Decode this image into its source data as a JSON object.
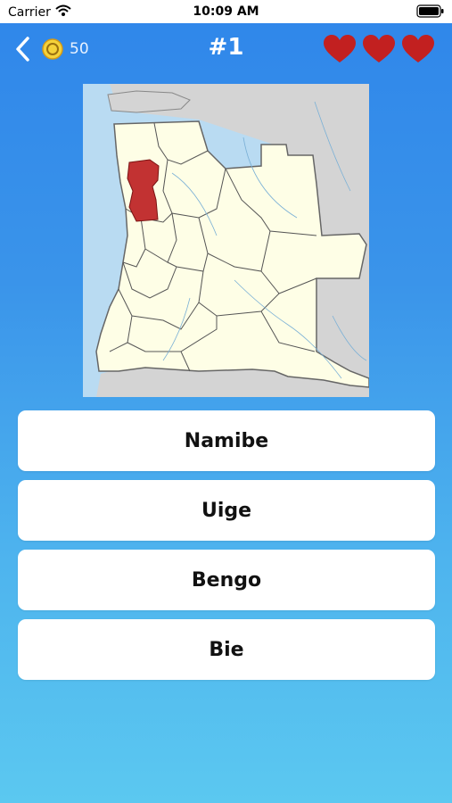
{
  "status_bar": {
    "carrier": "Carrier",
    "time": "10:09 AM"
  },
  "header": {
    "coins": "50",
    "title": "#1",
    "lives": 3
  },
  "answers": [
    {
      "label": "Namibe"
    },
    {
      "label": "Uige"
    },
    {
      "label": "Bengo"
    },
    {
      "label": "Bie"
    }
  ],
  "colors": {
    "highlight_region": "#c23232",
    "land": "#fefee6",
    "neighbor_land": "#d4d4d4",
    "water": "#b9dbf2",
    "heart": "#c22020",
    "coin": "#f5d23a"
  },
  "icons": {
    "back": "chevron-left-icon",
    "coin": "coin-icon",
    "life": "heart-icon",
    "wifi": "wifi-icon",
    "battery": "battery-icon"
  }
}
